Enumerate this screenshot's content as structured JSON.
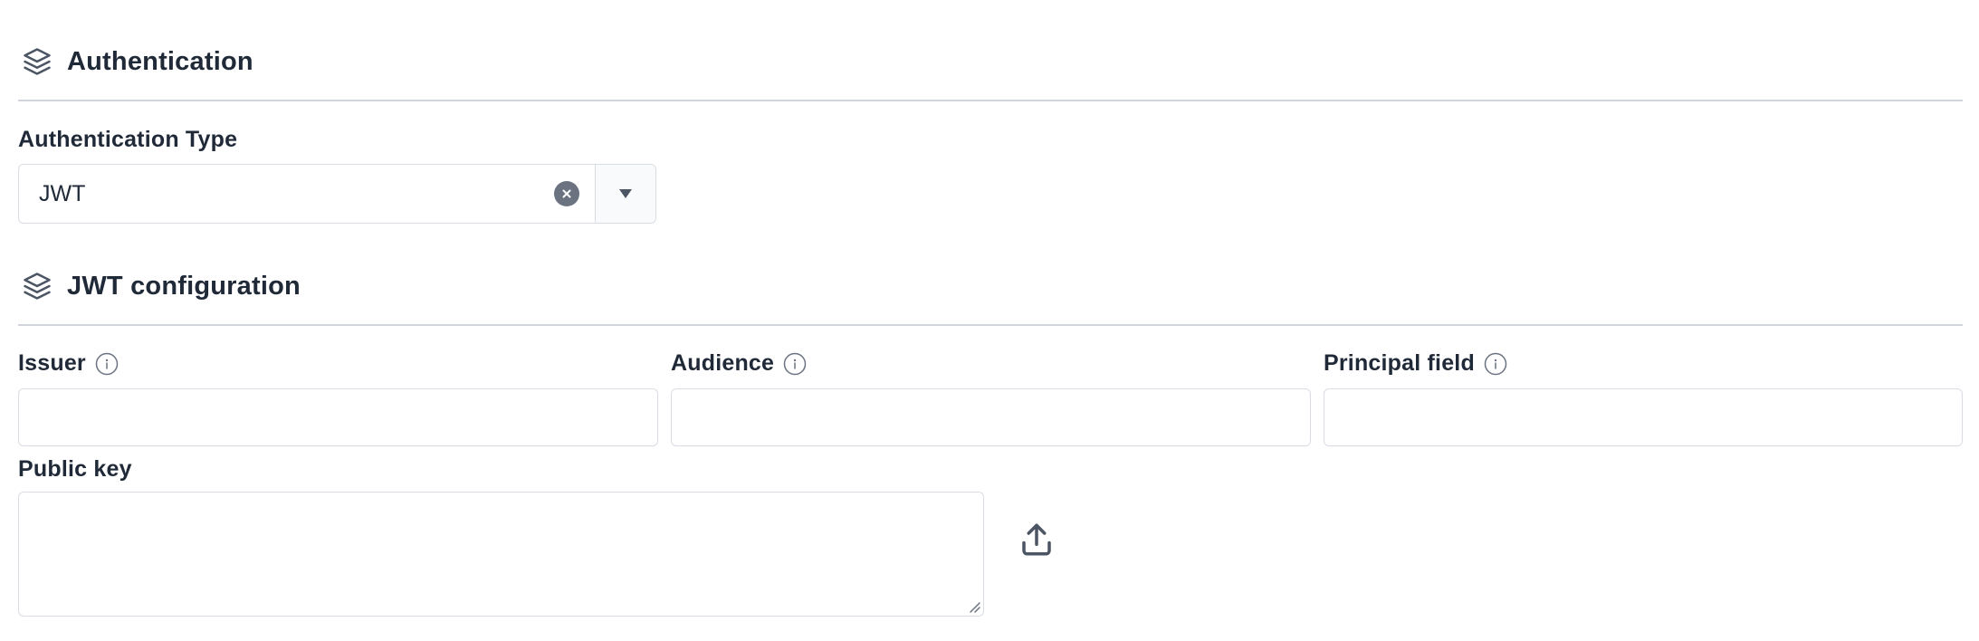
{
  "auth_section": {
    "title": "Authentication",
    "icon": "layers-icon"
  },
  "auth_type": {
    "label": "Authentication Type",
    "value": "JWT",
    "clear_icon": "close-circle-icon",
    "toggle_icon": "caret-down-icon"
  },
  "jwt_section": {
    "title": "JWT configuration",
    "icon": "layers-icon"
  },
  "issuer": {
    "label": "Issuer",
    "value": "",
    "info_icon": "info-icon"
  },
  "audience": {
    "label": "Audience",
    "value": "",
    "info_icon": "info-icon"
  },
  "principal_field": {
    "label": "Principal field",
    "value": "",
    "info_icon": "info-icon"
  },
  "public_key": {
    "label": "Public key",
    "value": "",
    "upload_icon": "upload-icon"
  },
  "colors": {
    "text": "#1f2937",
    "border": "#d9dde3",
    "divider": "#d1d5db",
    "clear_button": "#6b7280"
  }
}
